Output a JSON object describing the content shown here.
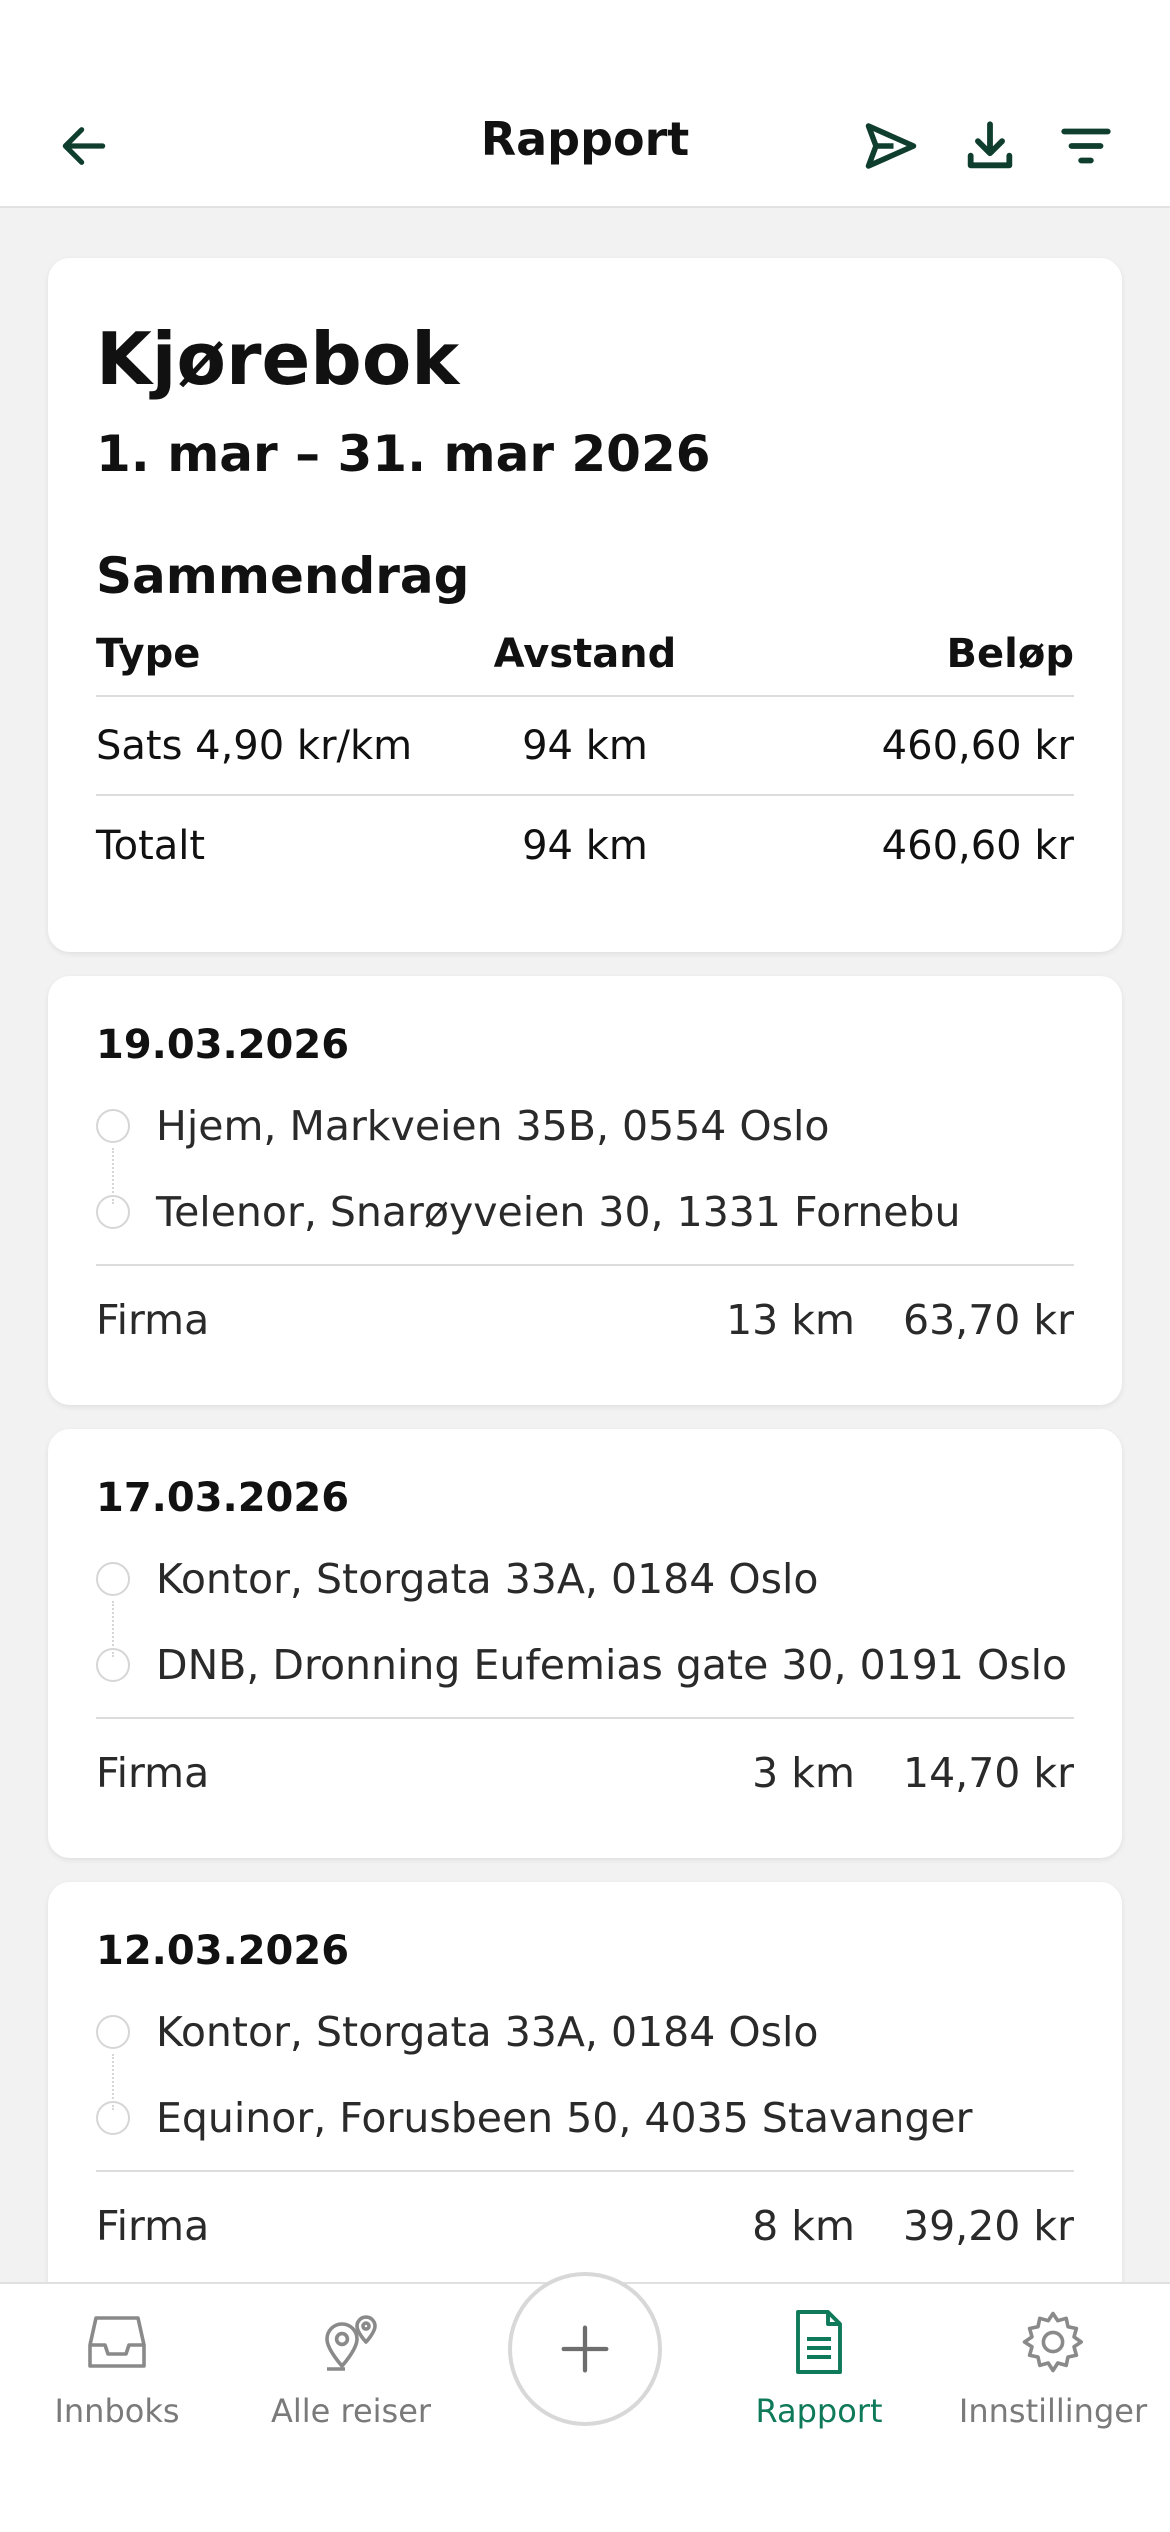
{
  "header": {
    "title": "Rapport",
    "icons": [
      "back-arrow-icon",
      "send-icon",
      "download-icon",
      "filter-icon"
    ]
  },
  "summary": {
    "title": "Kjørebok",
    "period": "1. mar – 31. mar 2026",
    "heading": "Sammendrag",
    "columns": [
      "Type",
      "Avstand",
      "Beløp"
    ],
    "rows": [
      {
        "type": "Sats 4,90 kr/km",
        "distance": "94 km",
        "amount": "460,60 kr"
      },
      {
        "type": "Totalt",
        "distance": "94 km",
        "amount": "460,60 kr"
      }
    ]
  },
  "trips": [
    {
      "date": "19.03.2026",
      "from": "Hjem, Markveien 35B, 0554 Oslo",
      "to": "Telenor, Snarøyveien 30, 1331 Fornebu",
      "category": "Firma",
      "distance": "13 km",
      "amount": "63,70 kr"
    },
    {
      "date": "17.03.2026",
      "from": "Kontor, Storgata 33A, 0184 Oslo",
      "to": "DNB, Dronning Eufemias gate 30, 0191 Oslo",
      "category": "Firma",
      "distance": "3 km",
      "amount": "14,70 kr"
    },
    {
      "date": "12.03.2026",
      "from": "Kontor, Storgata 33A, 0184 Oslo",
      "to": "Equinor, Forusbeen 50, 4035 Stavanger",
      "category": "Firma",
      "distance": "8 km",
      "amount": "39,20 kr"
    }
  ],
  "tabbar": {
    "tabs": [
      {
        "label": "Innboks",
        "icon": "inbox-icon"
      },
      {
        "label": "Alle reiser",
        "icon": "map-pins-icon"
      },
      {
        "label": "Rapport",
        "icon": "document-icon",
        "active": true
      },
      {
        "label": "Innstillinger",
        "icon": "gear-icon"
      }
    ],
    "fab_icon": "plus-icon"
  },
  "colors": {
    "accent": "#0f7a5a",
    "icon_dark": "#0f3d2e",
    "background": "#f2f2f2",
    "inactive": "#7a7a7a"
  }
}
